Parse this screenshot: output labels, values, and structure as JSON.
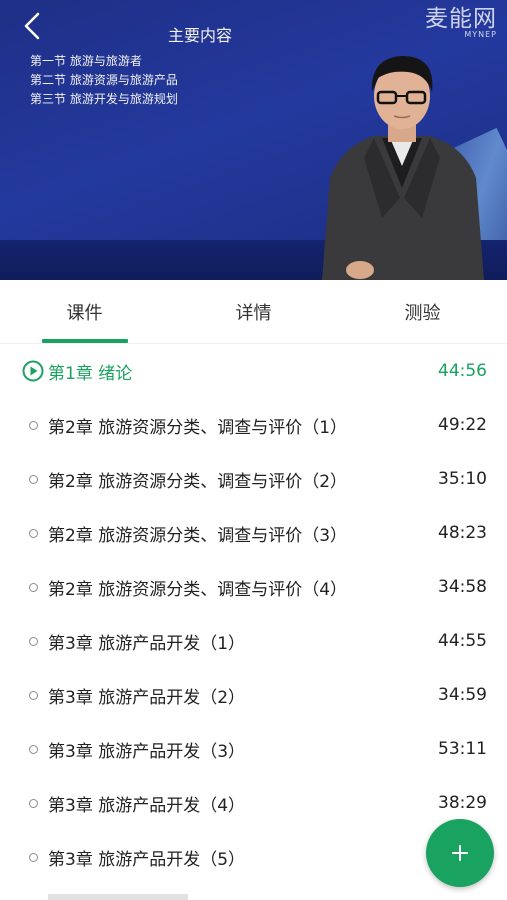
{
  "video": {
    "slide_title": "主要内容",
    "slide_items": [
      "第一节  旅游与旅游者",
      "第二节  旅游资源与旅游产品",
      "第三节  旅游开发与旅游规划"
    ],
    "watermark_cn": "麦能网",
    "watermark_en": "MYNEP"
  },
  "tabs": [
    {
      "label": "课件",
      "active": true
    },
    {
      "label": "详情",
      "active": false
    },
    {
      "label": "测验",
      "active": false
    }
  ],
  "chapters": [
    {
      "title": "第1章 绪论",
      "duration": "44:56",
      "playing": true
    },
    {
      "title": "第2章 旅游资源分类、调查与评价（1）",
      "duration": "49:22"
    },
    {
      "title": "第2章 旅游资源分类、调查与评价（2）",
      "duration": "35:10"
    },
    {
      "title": "第2章 旅游资源分类、调查与评价（3）",
      "duration": "48:23"
    },
    {
      "title": "第2章 旅游资源分类、调查与评价（4）",
      "duration": "34:58"
    },
    {
      "title": "第3章 旅游产品开发（1）",
      "duration": "44:55"
    },
    {
      "title": "第3章 旅游产品开发（2）",
      "duration": "34:59"
    },
    {
      "title": "第3章 旅游产品开发（3）",
      "duration": "53:11"
    },
    {
      "title": "第3章 旅游产品开发（4）",
      "duration": "38:29"
    },
    {
      "title": "第3章 旅游产品开发（5）",
      "duration": ""
    }
  ],
  "colors": {
    "accent": "#1aa260",
    "video_bg": "#22379a"
  },
  "icons": {
    "back": "chevron-left-icon",
    "play": "play-circle-icon",
    "fab": "plus-icon"
  }
}
